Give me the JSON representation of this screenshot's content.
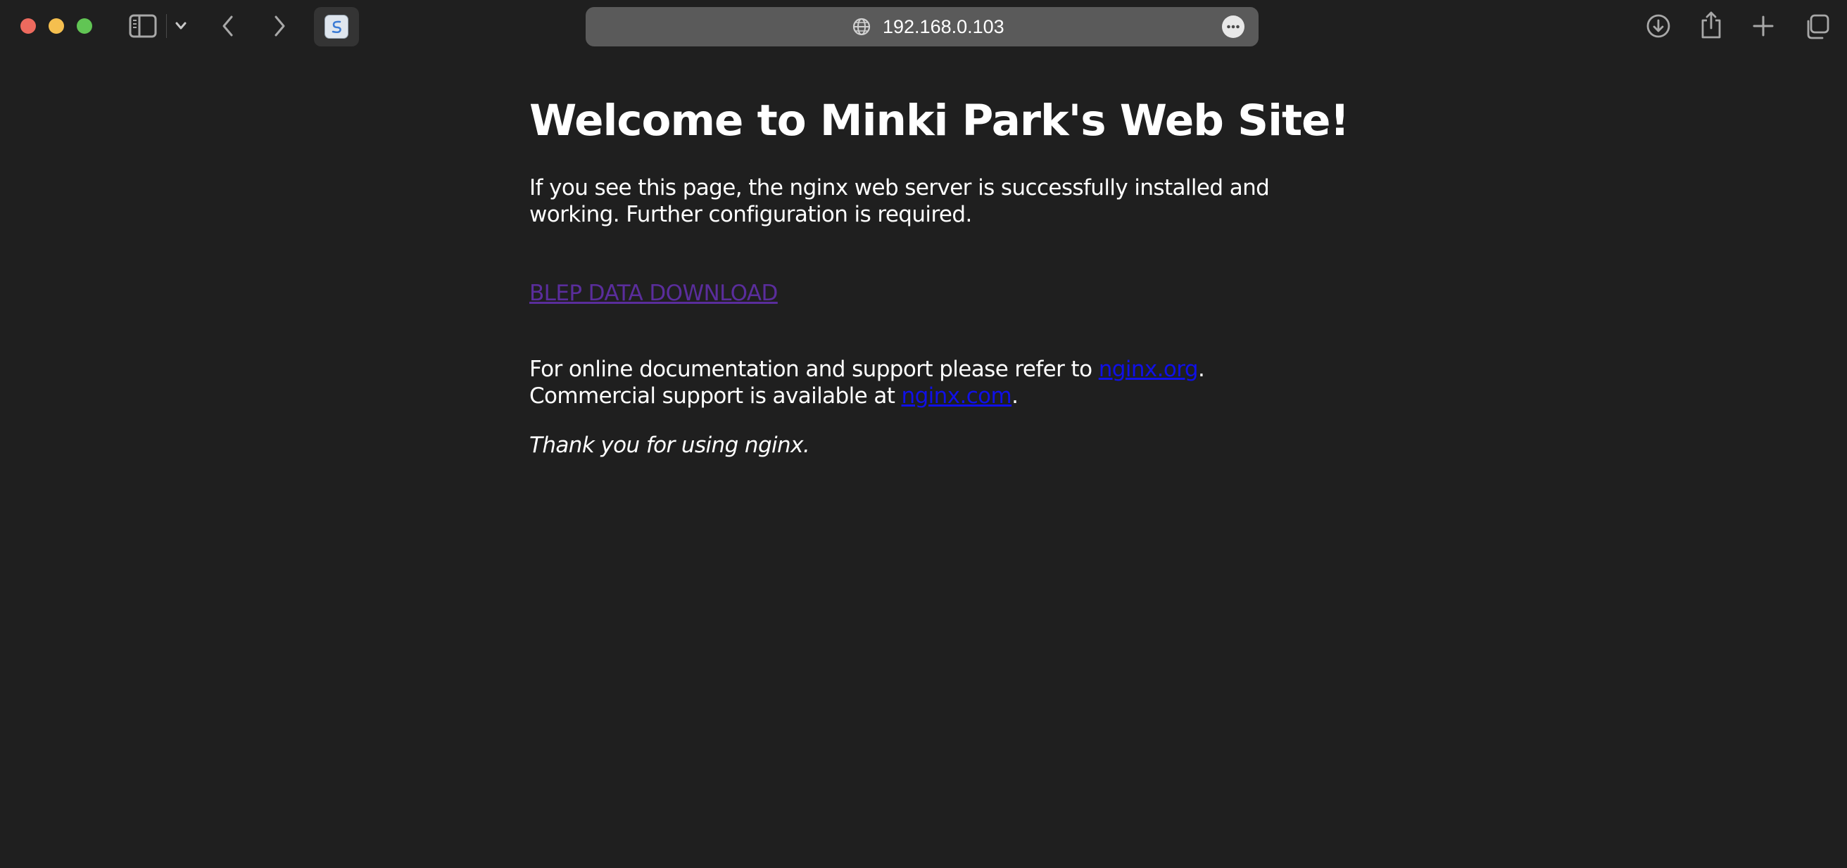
{
  "browser": {
    "url": "192.168.0.103",
    "icons": {
      "close": "close-traffic-light",
      "minimize": "minimize-traffic-light",
      "maximize": "maximize-traffic-light",
      "sidebar": "sidebar-icon",
      "tab_group_menu": "chevron-down-icon",
      "back": "back-icon",
      "forward": "forward-icon",
      "favicon": "site-favicon",
      "address_globe": "globe-icon",
      "page_menu": "more-icon",
      "downloads": "download-icon",
      "share": "share-icon",
      "new_tab": "plus-icon",
      "tab_overview": "tabs-icon"
    },
    "colors": {
      "background": "#1f1f1f",
      "address_bar": "#5a5a5a",
      "close": "#ed6a5e",
      "minimize": "#f5bf4f",
      "maximize": "#61c554"
    }
  },
  "page": {
    "title": "Welcome to Minki Park's Web Site!",
    "intro_line1": "If you see this page, the nginx web server is successfully installed and",
    "intro_line2": "working. Further configuration is required.",
    "download_link": "BLEP DATA DOWNLOAD",
    "doc_prefix": "For online documentation and support please refer to ",
    "doc_link": "nginx.org",
    "doc_suffix": ".",
    "commercial_prefix": "Commercial support is available at ",
    "commercial_link": "nginx.com",
    "commercial_suffix": ".",
    "thanks": "Thank you for using nginx.",
    "colors": {
      "text": "#ffffff",
      "visited_link": "#5a2d9c",
      "link": "#1010e8"
    }
  }
}
